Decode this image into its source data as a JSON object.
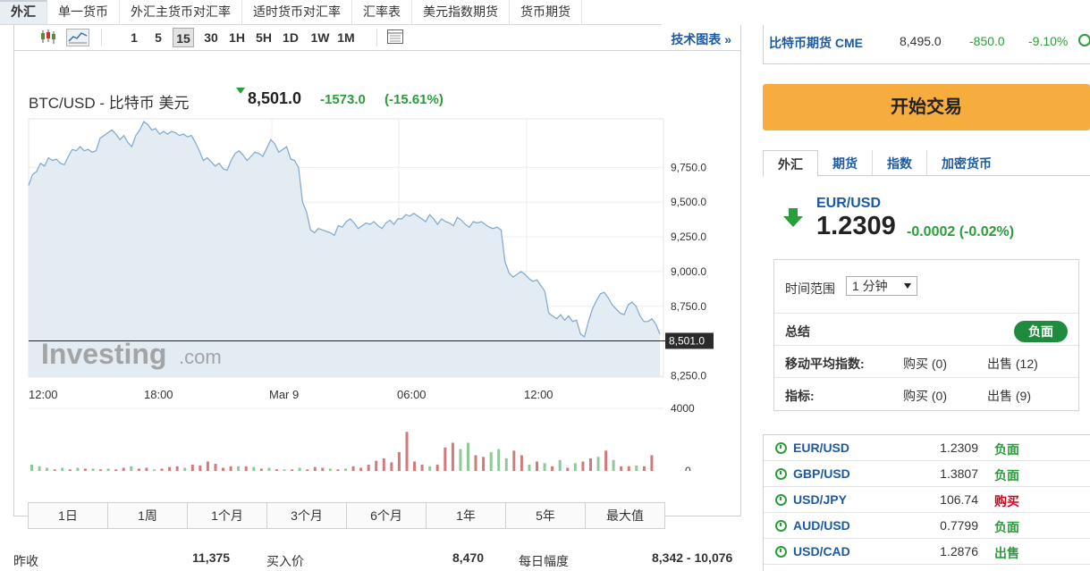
{
  "topnav": [
    "外汇",
    "单一货币",
    "外汇主货币对汇率",
    "适时货币对汇率",
    "汇率表",
    "美元指数期货",
    "货币期货"
  ],
  "toolbar": {
    "intervals": [
      "1",
      "5",
      "15",
      "30",
      "1H",
      "5H",
      "1D",
      "1W",
      "1M"
    ],
    "selected_interval": "15",
    "tech_chart": "技术图表 »"
  },
  "instrument": {
    "name": "BTC/USD - 比特币 美元",
    "price": "8,501.0",
    "change": "-1573.0",
    "change_pct": "(-15.61%)"
  },
  "watermark": {
    "brand": "Investing",
    "suffix": ".com"
  },
  "chart_data": {
    "type": "area",
    "y_ticks": [
      "9,750.0",
      "9,500.0",
      "9,250.0",
      "9,000.0",
      "8,750.0",
      "8,250.0"
    ],
    "current_label": "8,501.0",
    "x_ticks": [
      "12:00",
      "18:00",
      "Mar 9",
      "06:00",
      "12:00"
    ],
    "ylim": [
      8240,
      10100
    ],
    "price_series": [
      9620,
      9700,
      9720,
      9780,
      9760,
      9820,
      9800,
      9810,
      9780,
      9770,
      9830,
      9880,
      9870,
      9900,
      9870,
      9880,
      9860,
      9870,
      9960,
      9980,
      10000,
      10020,
      9990,
      9950,
      9980,
      9930,
      9900,
      9980,
      10020,
      10080,
      10060,
      10020,
      10030,
      9990,
      10010,
      9990,
      10010,
      10000,
      9980,
      9990,
      9970,
      9980,
      9930,
      9870,
      9800,
      9820,
      9790,
      9760,
      9780,
      9740,
      9730,
      9800,
      9850,
      9870,
      9840,
      9800,
      9830,
      9860,
      9850,
      9830,
      9890,
      9950,
      9920,
      9860,
      9880,
      9900,
      9810,
      9800,
      9750,
      9500,
      9430,
      9300,
      9280,
      9310,
      9300,
      9290,
      9280,
      9260,
      9330,
      9320,
      9360,
      9380,
      9350,
      9310,
      9330,
      9350,
      9340,
      9360,
      9330,
      9310,
      9350,
      9370,
      9340,
      9380,
      9380,
      9410,
      9400,
      9420,
      9400,
      9380,
      9360,
      9410,
      9380,
      9340,
      9380,
      9360,
      9350,
      9330,
      9390,
      9370,
      9340,
      9320,
      9360,
      9350,
      9360,
      9340,
      9320,
      9310,
      9320,
      9300,
      9070,
      8990,
      8960,
      8980,
      9000,
      8980,
      8950,
      8930,
      8940,
      8900,
      8860,
      8700,
      8680,
      8660,
      8690,
      8650,
      8680,
      8640,
      8650,
      8550,
      8530,
      8640,
      8730,
      8790,
      8840,
      8850,
      8810,
      8760,
      8730,
      8700,
      8690,
      8760,
      8780,
      8750,
      8680,
      8640,
      8640,
      8660,
      8620,
      8550
    ],
    "volume_scale": [
      0,
      4000
    ],
    "volume_ticks": [
      "4000",
      "0"
    ],
    "volume": [
      400,
      300,
      200,
      -100,
      200,
      -100,
      200,
      -150,
      150,
      -100,
      150,
      -100,
      -200,
      300,
      -150,
      -200,
      100,
      -150,
      -250,
      -300,
      200,
      -400,
      -350,
      -600,
      -450,
      -200,
      -300,
      300,
      -300,
      250,
      -150,
      200,
      -100,
      100,
      -100,
      200,
      -100,
      -250,
      -200,
      150,
      -100,
      150,
      -300,
      -200,
      -400,
      -650,
      -800,
      -550,
      -1200,
      -2500,
      -600,
      -400,
      300,
      -400,
      -1500,
      -1800,
      1400,
      1800,
      -1000,
      -900,
      1200,
      1400,
      800,
      -1300,
      -1000,
      400,
      -600,
      500,
      -300,
      700,
      -200,
      500,
      -600,
      -800,
      900,
      -1300,
      700,
      -300,
      -300,
      350,
      -300,
      -1000
    ]
  },
  "ranges": [
    "1日",
    "1周",
    "1个月",
    "3个月",
    "6个月",
    "1年",
    "5年",
    "最大值"
  ],
  "stats": {
    "prev_close_label": "昨收",
    "prev_close": "11,375",
    "bid_label": "买入价",
    "bid": "8,470",
    "day_range_label": "每日幅度",
    "day_range": "8,342 - 10,076"
  },
  "cme": {
    "name": "比特币期货 CME",
    "price": "8,495.0",
    "change": "-850.0",
    "change_pct": "-9.10%"
  },
  "trade_button": "开始交易",
  "market_tabs": [
    "外汇",
    "期货",
    "指数",
    "加密货币"
  ],
  "quote": {
    "symbol": "EUR/USD",
    "price": "1.2309",
    "change": "-0.0002 (-0.02%)"
  },
  "technical": {
    "timeframe_label": "时间范围",
    "timeframe_value": "1 分钟",
    "summary_label": "总结",
    "summary_value": "负面",
    "ma_label": "移动平均指数:",
    "ma_buy": "购买 (0)",
    "ma_sell": "出售 (12)",
    "ind_label": "指标:",
    "ind_buy": "购买 (0)",
    "ind_sell": "出售 (9)"
  },
  "pairs": [
    {
      "name": "EUR/USD",
      "value": "1.2309",
      "signal": "负面",
      "color": "#2a9d3c"
    },
    {
      "name": "GBP/USD",
      "value": "1.3807",
      "signal": "负面",
      "color": "#2a9d3c"
    },
    {
      "name": "USD/JPY",
      "value": "106.74",
      "signal": "购买",
      "color": "#d0021b"
    },
    {
      "name": "AUD/USD",
      "value": "0.7799",
      "signal": "负面",
      "color": "#2a9d3c"
    },
    {
      "name": "USD/CAD",
      "value": "1.2876",
      "signal": "出售",
      "color": "#2a9d3c"
    }
  ],
  "colors": {
    "positive": "#2a9d3c",
    "negative": "#d0021b",
    "link": "#1b5aa3",
    "trade": "#f6ad3d",
    "summary_badge": "#1e8b3d"
  }
}
